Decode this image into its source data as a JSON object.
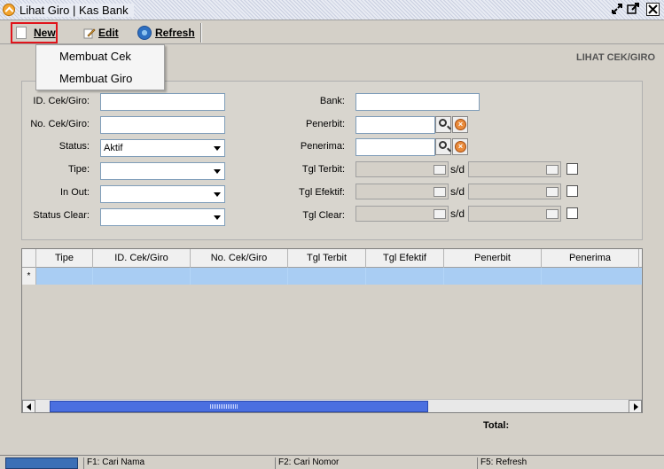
{
  "window": {
    "title": "Lihat Giro | Kas Bank"
  },
  "toolbar": {
    "new_label": "New",
    "edit_label": "Edit",
    "refresh_label": "Refresh"
  },
  "new_menu": {
    "items": [
      "Membuat Cek",
      "Membuat Giro"
    ]
  },
  "header": {
    "title": "LIHAT CEK/GIRO"
  },
  "filters": {
    "id_label": "ID. Cek/Giro:",
    "no_label": "No. Cek/Giro:",
    "status_label": "Status:",
    "status_value": "Aktif",
    "tipe_label": "Tipe:",
    "inout_label": "In Out:",
    "status_clear_label": "Status Clear:",
    "bank_label": "Bank:",
    "penerbit_label": "Penerbit:",
    "penerima_label": "Penerima:",
    "tgl_terbit_label": "Tgl Terbit:",
    "tgl_efektif_label": "Tgl Efektif:",
    "tgl_clear_label": "Tgl Clear:",
    "range_sep": "s/d"
  },
  "grid": {
    "columns": [
      "Tipe",
      "ID. Cek/Giro",
      "No. Cek/Giro",
      "Tgl Terbit",
      "Tgl Efektif",
      "Penerbit",
      "Penerima"
    ],
    "new_row_marker": "*"
  },
  "footer": {
    "total_label": "Total:"
  },
  "statusbar": {
    "f1": "F1: Cari Nama",
    "f2": "F2: Cari Nomor",
    "f5": "F5: Refresh"
  }
}
